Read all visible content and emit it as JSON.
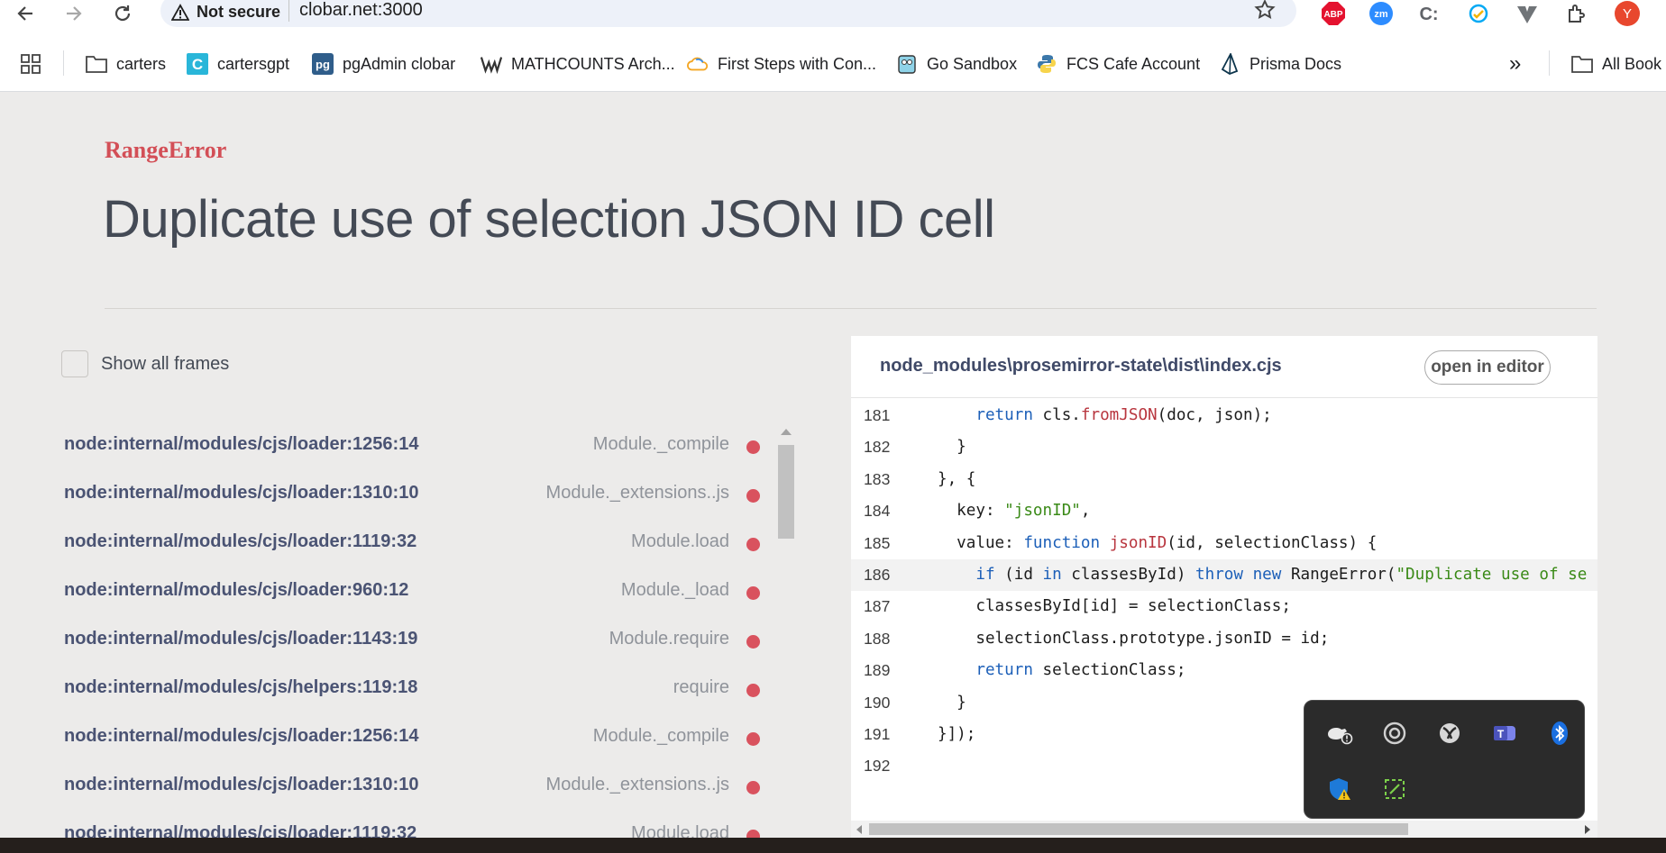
{
  "browser": {
    "security_label": "Not secure",
    "url": "clobar.net:3000",
    "profile_initial": "Y",
    "extensions": [
      {
        "name": "adblock-plus",
        "label": "ABP",
        "color": "#e4122f"
      },
      {
        "name": "zoom",
        "label": "zm",
        "color": "#2d8cff"
      },
      {
        "name": "codeium",
        "label": "C:",
        "color": "#606368"
      },
      {
        "name": "clockify",
        "label": "",
        "color": "#03a9f4"
      },
      {
        "name": "vuetify",
        "label": "",
        "color": "#5f6368"
      }
    ],
    "accent": "#e8472e"
  },
  "bookmarks": [
    {
      "label": "carters",
      "icon": "folder-icon"
    },
    {
      "label": "cartersgpt",
      "icon": "c-logo-icon"
    },
    {
      "label": "pgAdmin clobar",
      "icon": "pgadmin-icon"
    },
    {
      "label": "MATHCOUNTS Arch...",
      "icon": "mathcounts-icon"
    },
    {
      "label": "First Steps with Con...",
      "icon": "cloud-icon"
    },
    {
      "label": "Go Sandbox",
      "icon": "gopher-icon"
    },
    {
      "label": "FCS Cafe Account",
      "icon": "python-icon"
    },
    {
      "label": "Prisma Docs",
      "icon": "prisma-icon"
    }
  ],
  "bookmarks_more": "»",
  "all_bookmarks": "All Book",
  "error": {
    "type": "RangeError",
    "message": "Duplicate use of selection JSON ID cell"
  },
  "show_all_frames": "Show all frames",
  "frames": [
    {
      "file": "node:internal/modules/cjs/loader:1256:14",
      "fn": "Module._compile"
    },
    {
      "file": "node:internal/modules/cjs/loader:1310:10",
      "fn": "Module._extensions..js"
    },
    {
      "file": "node:internal/modules/cjs/loader:1119:32",
      "fn": "Module.load"
    },
    {
      "file": "node:internal/modules/cjs/loader:960:12",
      "fn": "Module._load"
    },
    {
      "file": "node:internal/modules/cjs/loader:1143:19",
      "fn": "Module.require"
    },
    {
      "file": "node:internal/modules/cjs/helpers:119:18",
      "fn": "require"
    },
    {
      "file": "node:internal/modules/cjs/loader:1256:14",
      "fn": "Module._compile"
    },
    {
      "file": "node:internal/modules/cjs/loader:1310:10",
      "fn": "Module._extensions..js"
    },
    {
      "file": "node:internal/modules/cjs/loader:1119:32",
      "fn": "Module.load"
    }
  ],
  "code": {
    "file": "node_modules\\prosemirror-state\\dist\\index.cjs",
    "open_editor": "open in editor",
    "highlight_line": "186",
    "lines": [
      {
        "num": "181",
        "src": "    return cls.fromJSON(doc, json);"
      },
      {
        "num": "182",
        "src": "  }"
      },
      {
        "num": "183",
        "src": "}, {"
      },
      {
        "num": "184",
        "src": "  key: \"jsonID\","
      },
      {
        "num": "185",
        "src": "  value: function jsonID(id, selectionClass) {"
      },
      {
        "num": "186",
        "src": "    if (id in classesById) throw new RangeError(\"Duplicate use of se"
      },
      {
        "num": "187",
        "src": "    classesById[id] = selectionClass;"
      },
      {
        "num": "188",
        "src": "    selectionClass.prototype.jsonID = id;"
      },
      {
        "num": "189",
        "src": "    return selectionClass;"
      },
      {
        "num": "190",
        "src": "  }"
      },
      {
        "num": "191",
        "src": "}]);"
      },
      {
        "num": "192",
        "src": ""
      }
    ]
  },
  "tray_icons": [
    "steam-icon",
    "obs-icon",
    "xbox-icon",
    "teams-icon",
    "bluetooth-icon",
    "windows-security-warning-icon",
    "snipping-tool-icon"
  ]
}
